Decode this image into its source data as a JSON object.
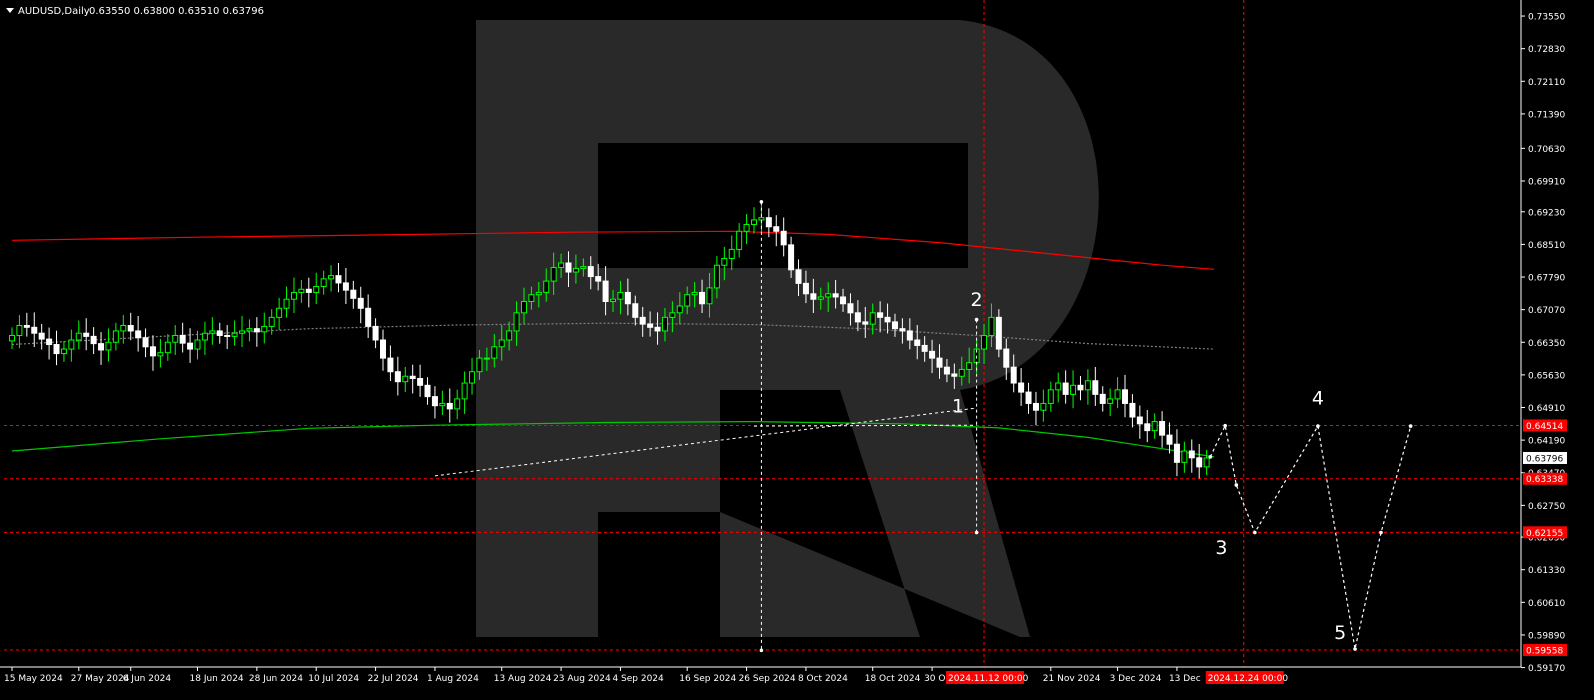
{
  "header": {
    "symbol": "AUDUSD,Daily",
    "ohlc": "0.63550 0.63800 0.63510 0.63796"
  },
  "colors": {
    "background": "#000000",
    "bull": "#00ff00",
    "bear": "#ffffff",
    "ma_long": "#ff0000",
    "ma_mid": "#808080",
    "ma_short": "#00c800",
    "grid_red": "#ff0000",
    "forecast": "#ffffff",
    "axis_text": "#ffffff",
    "watermark": "#4a4a4a",
    "price_tag_red": "#ff0000"
  },
  "chart_data": {
    "type": "candlestick",
    "y_axis_ticks": [
      "0.73550",
      "0.72830",
      "0.72110",
      "0.71390",
      "0.70630",
      "0.69910",
      "0.69230",
      "0.68510",
      "0.67790",
      "0.67070",
      "0.66350",
      "0.65630",
      "0.64910",
      "0.64190",
      "0.63470",
      "0.62750",
      "0.62050",
      "0.61330",
      "0.60610",
      "0.59890",
      "0.59170"
    ],
    "y_min": 0.5905,
    "y_max": 0.7375,
    "x_axis_ticks": [
      {
        "i": 0,
        "label": "15 May 2024"
      },
      {
        "i": 9,
        "label": "27 May 2024"
      },
      {
        "i": 16,
        "label": "6 Jun 2024"
      },
      {
        "i": 25,
        "label": "18 Jun 2024"
      },
      {
        "i": 33,
        "label": "28 Jun 2024"
      },
      {
        "i": 41,
        "label": "10 Jul 2024"
      },
      {
        "i": 49,
        "label": "22 Jul 2024"
      },
      {
        "i": 57,
        "label": "1 Aug 2024"
      },
      {
        "i": 66,
        "label": "13 Aug 2024"
      },
      {
        "i": 74,
        "label": "23 Aug 2024"
      },
      {
        "i": 82,
        "label": "4 Sep 2024"
      },
      {
        "i": 91,
        "label": "16 Sep 2024"
      },
      {
        "i": 99,
        "label": "26 Sep 2024"
      },
      {
        "i": 107,
        "label": "8 Oct 2024"
      },
      {
        "i": 116,
        "label": "18 Oct 2024"
      },
      {
        "i": 124,
        "label": "30 Oct 2"
      },
      {
        "i": 140,
        "label": "21 Nov 2024"
      },
      {
        "i": 149,
        "label": "3 Dec 2024"
      },
      {
        "i": 157,
        "label": "13 Dec"
      }
    ],
    "x_time_tags": [
      {
        "i": 131,
        "label": "2024.11.12 00:00"
      },
      {
        "i": 166,
        "label": "2024.12.24 00:00"
      }
    ],
    "closes": [
      0.665,
      0.6672,
      0.6668,
      0.6655,
      0.6642,
      0.663,
      0.661,
      0.662,
      0.664,
      0.6655,
      0.6648,
      0.6632,
      0.6618,
      0.6635,
      0.666,
      0.6672,
      0.666,
      0.6645,
      0.6625,
      0.6605,
      0.6612,
      0.6635,
      0.665,
      0.6633,
      0.662,
      0.664,
      0.6655,
      0.666,
      0.665,
      0.6648,
      0.6655,
      0.666,
      0.6665,
      0.6658,
      0.667,
      0.669,
      0.671,
      0.673,
      0.6745,
      0.6752,
      0.6745,
      0.6758,
      0.6775,
      0.6782,
      0.6766,
      0.675,
      0.6732,
      0.671,
      0.667,
      0.664,
      0.66,
      0.657,
      0.6548,
      0.656,
      0.6555,
      0.654,
      0.6515,
      0.6495,
      0.65,
      0.6488,
      0.651,
      0.6545,
      0.657,
      0.66,
      0.66,
      0.6625,
      0.664,
      0.666,
      0.67,
      0.6725,
      0.674,
      0.6745,
      0.677,
      0.68,
      0.681,
      0.679,
      0.6798,
      0.6802,
      0.678,
      0.677,
      0.6725,
      0.673,
      0.6745,
      0.672,
      0.669,
      0.6675,
      0.6668,
      0.666,
      0.669,
      0.67,
      0.6715,
      0.674,
      0.6745,
      0.672,
      0.6755,
      0.6805,
      0.682,
      0.684,
      0.688,
      0.6895,
      0.6905,
      0.691,
      0.689,
      0.688,
      0.685,
      0.6795,
      0.6765,
      0.6742,
      0.673,
      0.6735,
      0.6742,
      0.6735,
      0.672,
      0.67,
      0.668,
      0.6675,
      0.67,
      0.669,
      0.668,
      0.6665,
      0.666,
      0.664,
      0.6628,
      0.6615,
      0.66,
      0.658,
      0.6565,
      0.656,
      0.6575,
      0.659,
      0.662,
      0.665,
      0.669,
      0.662,
      0.658,
      0.6545,
      0.6525,
      0.65,
      0.6485,
      0.65,
      0.653,
      0.6545,
      0.652,
      0.654,
      0.653,
      0.655,
      0.652,
      0.65,
      0.651,
      0.653,
      0.65,
      0.647,
      0.6455,
      0.644,
      0.646,
      0.643,
      0.641,
      0.637,
      0.6395,
      0.638,
      0.636,
      0.63796
    ],
    "ma_long": [
      [
        0,
        0.686
      ],
      [
        25,
        0.6867
      ],
      [
        50,
        0.6872
      ],
      [
        75,
        0.6878
      ],
      [
        97,
        0.688
      ],
      [
        110,
        0.6873
      ],
      [
        125,
        0.6855
      ],
      [
        140,
        0.683
      ],
      [
        155,
        0.6805
      ],
      [
        162,
        0.6796
      ]
    ],
    "ma_mid": [
      [
        0,
        0.663
      ],
      [
        20,
        0.6648
      ],
      [
        40,
        0.6665
      ],
      [
        60,
        0.6673
      ],
      [
        80,
        0.6677
      ],
      [
        100,
        0.6674
      ],
      [
        115,
        0.6665
      ],
      [
        130,
        0.665
      ],
      [
        145,
        0.6632
      ],
      [
        162,
        0.662
      ]
    ],
    "ma_short": [
      [
        0,
        0.6395
      ],
      [
        20,
        0.6422
      ],
      [
        40,
        0.6445
      ],
      [
        57,
        0.6452
      ],
      [
        80,
        0.6458
      ],
      [
        100,
        0.646
      ],
      [
        120,
        0.6455
      ],
      [
        133,
        0.6446
      ],
      [
        145,
        0.6425
      ],
      [
        155,
        0.64
      ],
      [
        162,
        0.6382
      ]
    ],
    "levels": [
      0.64514,
      0.63338,
      0.62155,
      0.59558
    ],
    "price_tags": [
      {
        "value": 0.64514,
        "label": "0.64514"
      },
      {
        "value": 0.63796,
        "label": "0.63796"
      },
      {
        "value": 0.63338,
        "label": "0.63338"
      },
      {
        "value": 0.62155,
        "label": "0.62155"
      },
      {
        "value": 0.59558,
        "label": "0.59558"
      }
    ],
    "vertical_time_lines": [
      131,
      166
    ],
    "forecast_path": [
      [
        161.5,
        0.6382
      ],
      [
        163.5,
        0.6451
      ],
      [
        165,
        0.632
      ],
      [
        167.5,
        0.6215
      ],
      [
        176,
        0.645
      ],
      [
        181,
        0.5958
      ],
      [
        184.5,
        0.6215
      ],
      [
        188.5,
        0.645
      ]
    ],
    "wave_labels": [
      {
        "label": "1",
        "i": 127.5,
        "y": 0.648
      },
      {
        "label": "2",
        "i": 130,
        "y": 0.6715
      },
      {
        "label": "3",
        "i": 163,
        "y": 0.6168
      },
      {
        "label": "4",
        "i": 176,
        "y": 0.6498
      },
      {
        "label": "5",
        "i": 179,
        "y": 0.598
      }
    ],
    "projections": [
      {
        "from": [
          57,
          0.634
        ],
        "to": [
          130,
          0.649
        ]
      },
      {
        "from": [
          100,
          0.645
        ],
        "to": [
          130,
          0.6452
        ]
      }
    ],
    "vertical_measures": [
      {
        "i": 101,
        "from": 0.6945,
        "to": 0.5955
      },
      {
        "i": 130,
        "from": 0.6685,
        "to": 0.6215
      }
    ],
    "watermark": "R"
  }
}
